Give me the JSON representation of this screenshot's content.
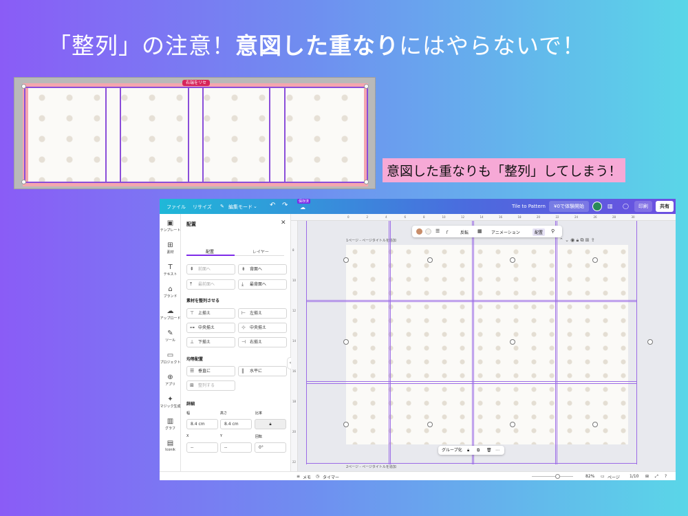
{
  "headline": {
    "part1": "「整列」の注意！",
    "part2": "意図した重なり",
    "part3": "にはやらないで！"
  },
  "shot1": {
    "tag_label": "右端をリセ"
  },
  "callout": "意図した重なりも「整列」してしまう！",
  "app": {
    "topbar": {
      "file": "ファイル",
      "resize": "リサイズ",
      "edit_mode": "編集モード",
      "undo_icon": "↶",
      "redo_icon": "↷",
      "saved_badge": "保存済",
      "title": "Tile to Pattern",
      "trial": "¥0で体験開始",
      "print": "印刷",
      "share": "共有"
    },
    "sidebar": [
      {
        "icon": "▣",
        "label": "テンプレート"
      },
      {
        "icon": "⊞",
        "label": "素材"
      },
      {
        "icon": "T",
        "label": "テキスト"
      },
      {
        "icon": "⌂",
        "label": "ブランド"
      },
      {
        "icon": "☁",
        "label": "アップロード"
      },
      {
        "icon": "✎",
        "label": "ツール"
      },
      {
        "icon": "▭",
        "label": "プロジェクト"
      },
      {
        "icon": "⊕",
        "label": "アプリ"
      },
      {
        "icon": "✦",
        "label": "マジック生成"
      },
      {
        "icon": "▥",
        "label": "グラフ"
      },
      {
        "icon": "▤",
        "label": "Iconik"
      }
    ],
    "panel": {
      "title": "配置",
      "tab_arrange": "配置",
      "tab_layer": "レイヤー",
      "forward": "前面へ",
      "backward": "背面へ",
      "front": "最前面へ",
      "back": "最背面へ",
      "align_heading": "素材を整列させる",
      "align_top": "上揃え",
      "align_left": "左揃え",
      "align_middle": "中央揃え",
      "align_center": "中央揃え",
      "align_bottom": "下揃え",
      "align_right": "右揃え",
      "spacing_heading": "均等配置",
      "vertical": "垂直に",
      "horizontal": "水平に",
      "tidy": "整列する",
      "detail_heading": "詳細",
      "width_label": "幅",
      "height_label": "高さ",
      "ratio_label": "比率",
      "width_value": "8.4 cm",
      "height_value": "8.4 cm",
      "x_label": "X",
      "y_label": "Y",
      "rotate_label": "回転",
      "x_value": "--",
      "y_value": "--",
      "rotate_value": "0°"
    },
    "ctx": {
      "flip": "反転",
      "animation": "アニメーション",
      "position": "配置"
    },
    "page1_label": "1ページ - ページタイトルを追加",
    "page2_label": "2ページ - ページタイトルを追加",
    "group_label": "グループ化",
    "bottom": {
      "notes": "メモ",
      "timer": "タイマー",
      "zoom": "82%",
      "pages": "ページ",
      "page_count": "1/10"
    },
    "ruler_top": [
      "0",
      "2",
      "4",
      "6",
      "8",
      "10",
      "12",
      "14",
      "16",
      "18",
      "20",
      "22",
      "24",
      "26",
      "28",
      "30"
    ],
    "ruler_left": [
      "8",
      "10",
      "12",
      "14",
      "16",
      "18",
      "20",
      "22"
    ]
  },
  "colors": {
    "accent": "#7d2ae8",
    "guide": "#9b6ae6",
    "pink": "#f4a6ae"
  }
}
